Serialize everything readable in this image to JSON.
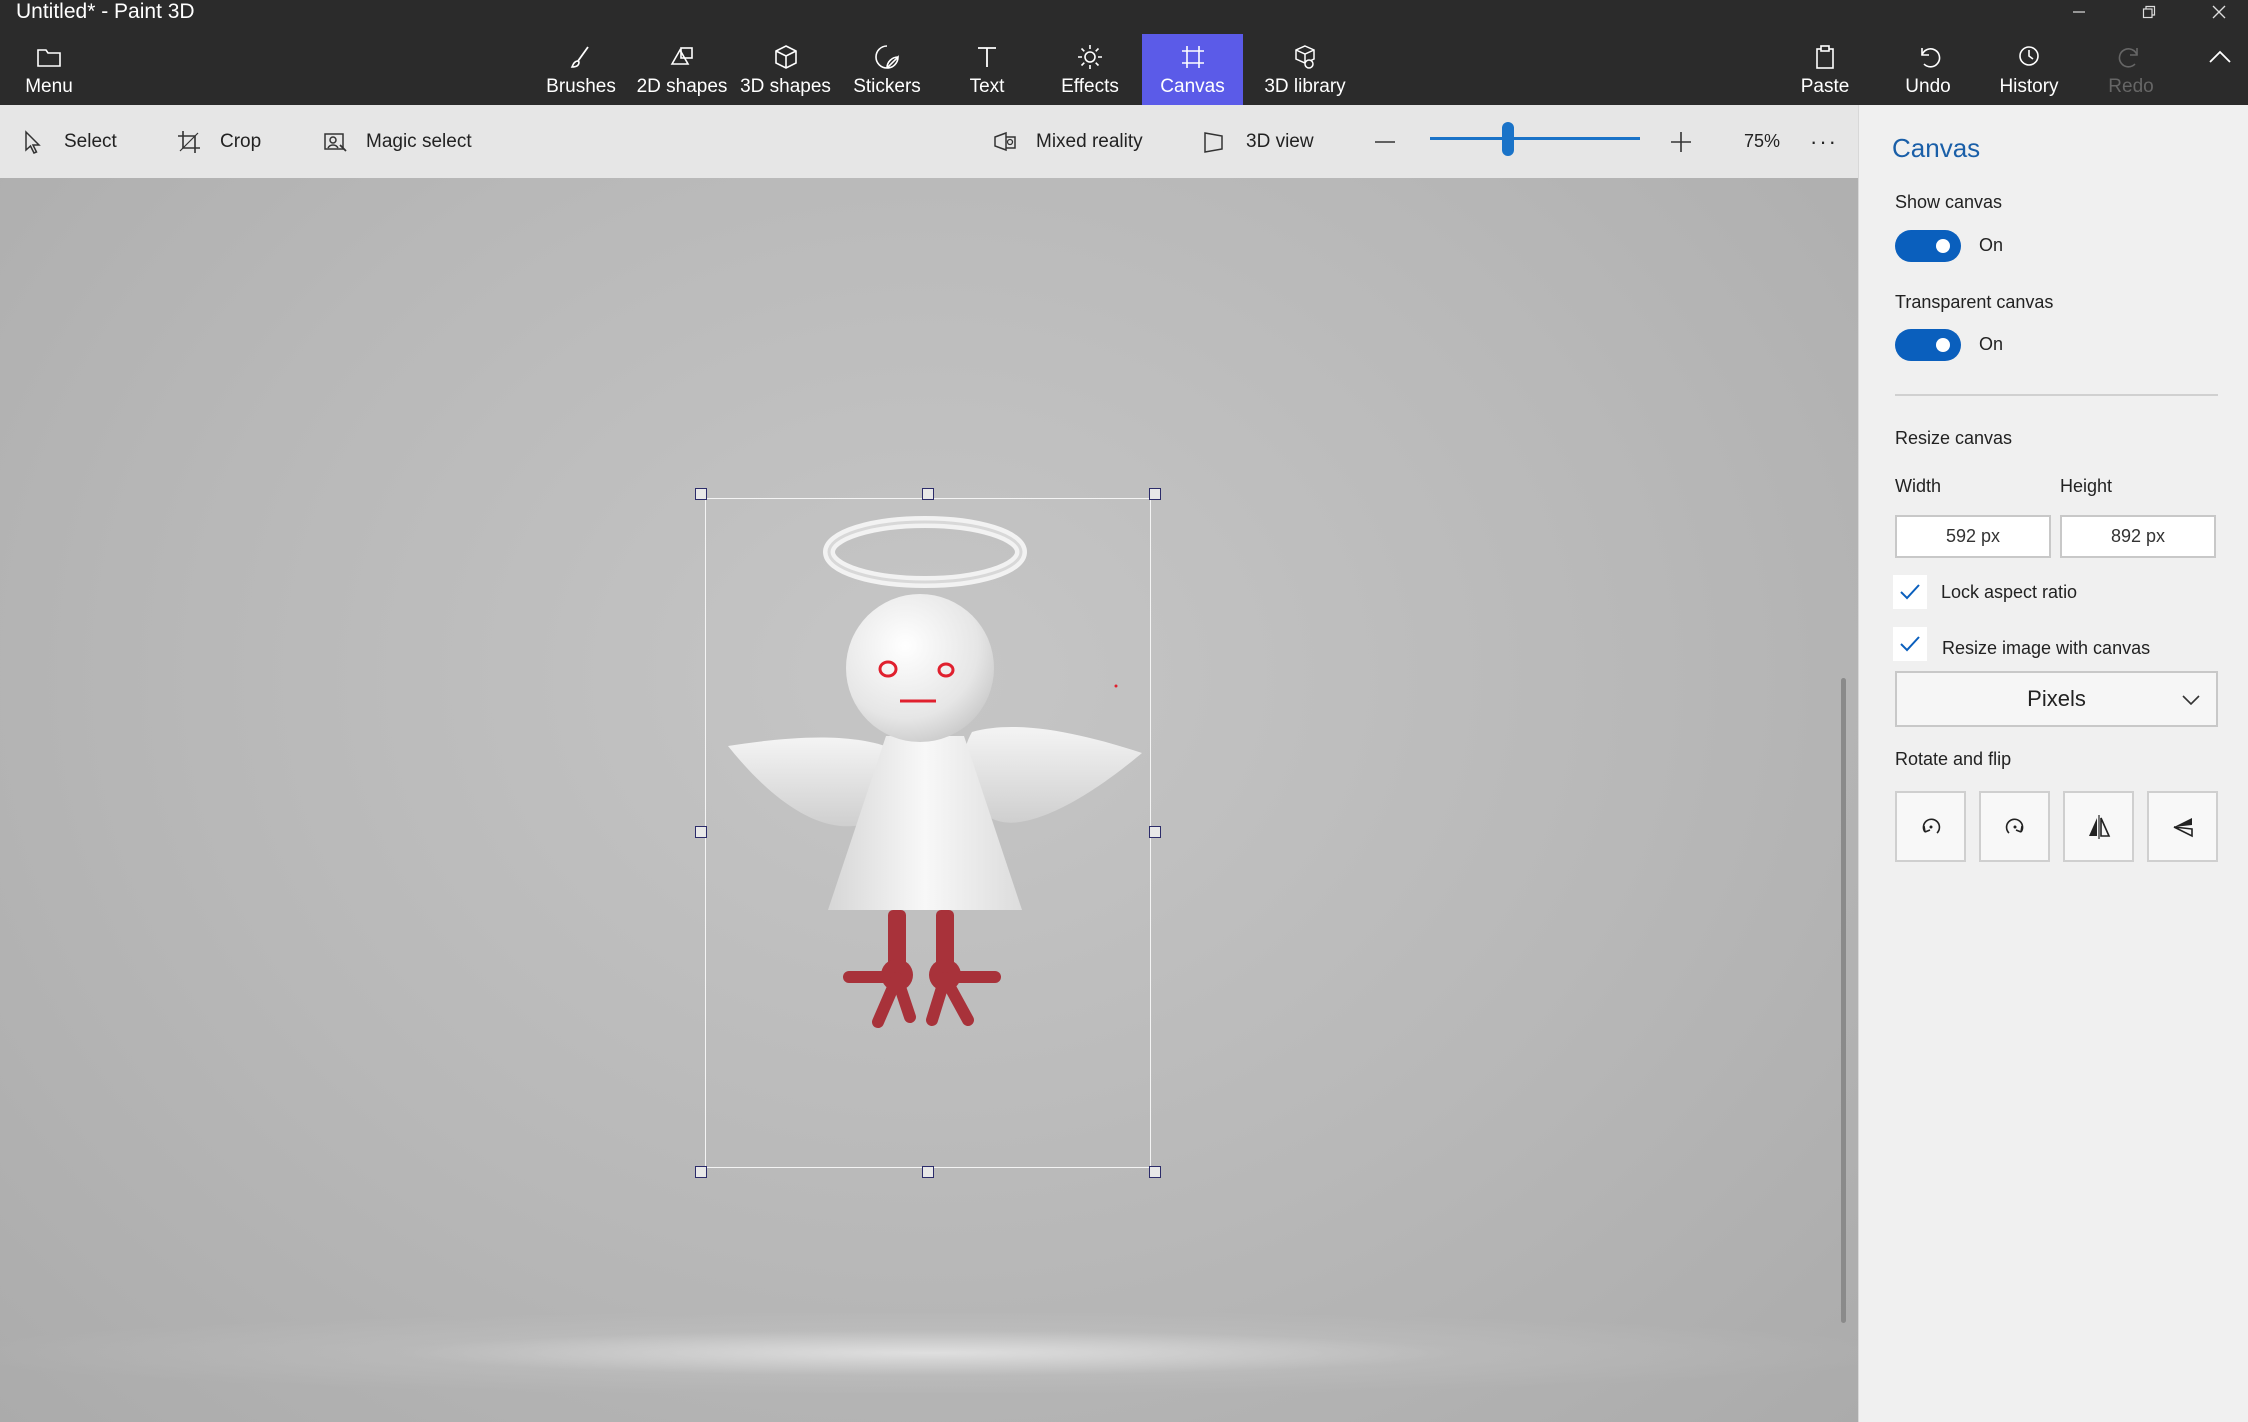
{
  "window": {
    "title": "Untitled* - Paint 3D"
  },
  "ribbon": {
    "menu_label": "Menu",
    "tools": [
      {
        "label": "Brushes",
        "icon": "brush-icon"
      },
      {
        "label": "2D shapes",
        "icon": "2d-shapes-icon"
      },
      {
        "label": "3D shapes",
        "icon": "3d-shapes-icon"
      },
      {
        "label": "Stickers",
        "icon": "stickers-icon"
      },
      {
        "label": "Text",
        "icon": "text-icon"
      },
      {
        "label": "Effects",
        "icon": "effects-icon"
      },
      {
        "label": "Canvas",
        "icon": "canvas-icon",
        "active": true
      },
      {
        "label": "3D library",
        "icon": "3d-library-icon"
      }
    ],
    "right_actions": [
      {
        "label": "Paste",
        "icon": "paste-icon"
      },
      {
        "label": "Undo",
        "icon": "undo-icon"
      },
      {
        "label": "History",
        "icon": "history-icon"
      },
      {
        "label": "Redo",
        "icon": "redo-icon",
        "disabled": true
      }
    ],
    "active_color": "#5b5be8"
  },
  "toolbar": {
    "select_label": "Select",
    "crop_label": "Crop",
    "magic_select_label": "Magic select",
    "mixed_reality_label": "Mixed reality",
    "view3d_label": "3D view",
    "zoom_level": "75%",
    "zoom_slider_fraction": 0.37
  },
  "panel": {
    "title": "Canvas",
    "show_canvas": {
      "label": "Show canvas",
      "state": "On"
    },
    "transparent_canvas": {
      "label": "Transparent canvas",
      "state": "On"
    },
    "resize_title": "Resize canvas",
    "width_label": "Width",
    "height_label": "Height",
    "width_value": "592 px",
    "height_value": "892 px",
    "lock_aspect_label": "Lock aspect ratio",
    "resize_image_label": "Resize image with canvas",
    "units_value": "Pixels",
    "rotate_title": "Rotate and flip",
    "rotate_buttons": [
      "rotate-left-icon",
      "rotate-right-icon",
      "flip-horizontal-icon",
      "flip-vertical-icon"
    ]
  },
  "colors": {
    "accent_blue": "#0a5fbd",
    "ribbon_bg": "#2b2b2b",
    "figure_red": "#a8323a"
  }
}
